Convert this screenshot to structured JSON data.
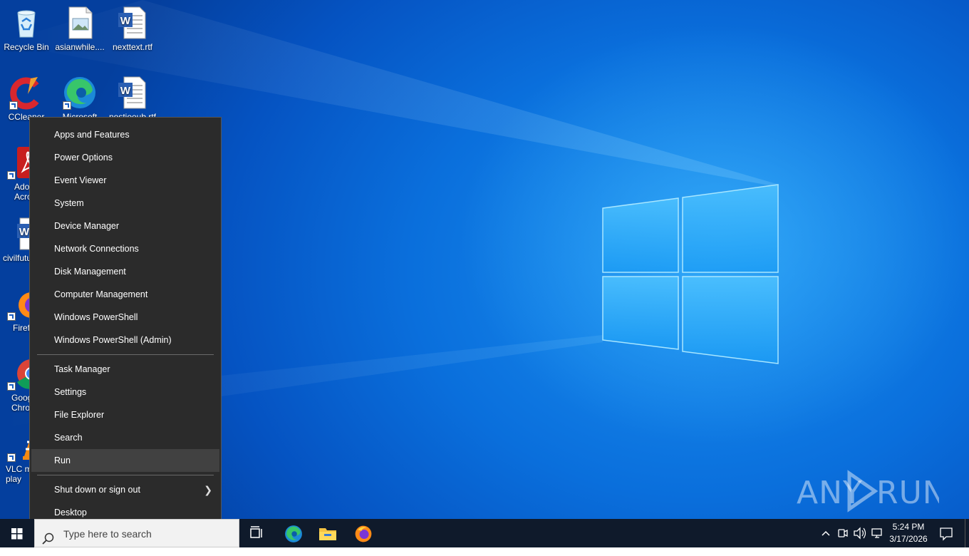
{
  "desktop": {
    "icons": [
      {
        "label": "Recycle Bin",
        "icon": "recycle-bin-icon"
      },
      {
        "label": "asianwhile....",
        "icon": "image-file-icon"
      },
      {
        "label": "nexttext.rtf",
        "icon": "word-document-icon"
      },
      {
        "label": "CCleaner",
        "icon": "ccleaner-icon"
      },
      {
        "label": "Microsoft",
        "icon": "edge-icon"
      },
      {
        "label": "nostjoeub.rtf",
        "icon": "word-document-icon"
      },
      {
        "label": "Ado Acro",
        "icon": "acrobat-icon"
      },
      {
        "label": "civilfutu",
        "icon": "word-document-icon"
      },
      {
        "label": "Firef",
        "icon": "firefox-icon"
      },
      {
        "label": "Goog Chro",
        "icon": "chrome-icon"
      },
      {
        "label": "VLC m play",
        "icon": "vlc-icon"
      }
    ]
  },
  "context_menu": {
    "group1": [
      "Apps and Features",
      "Power Options",
      "Event Viewer",
      "System",
      "Device Manager",
      "Network Connections",
      "Disk Management",
      "Computer Management",
      "Windows PowerShell",
      "Windows PowerShell (Admin)"
    ],
    "group2": [
      "Task Manager",
      "Settings",
      "File Explorer",
      "Search",
      "Run"
    ],
    "group3": [
      "Shut down or sign out",
      "Desktop"
    ],
    "highlighted": "Run"
  },
  "taskbar": {
    "search_placeholder": "Type here to search",
    "pinned": [
      "task-view-icon",
      "edge-icon",
      "file-explorer-icon",
      "firefox-icon"
    ],
    "clock_time": "5:24 PM",
    "clock_date": "3/17/2026"
  },
  "watermark": "ANY RUN",
  "colors": {
    "menu_bg": "#2b2b2b",
    "menu_hover": "#414141",
    "taskbar_bg": "#0f1a2b",
    "desktop_blue": "#0a6fdc"
  }
}
